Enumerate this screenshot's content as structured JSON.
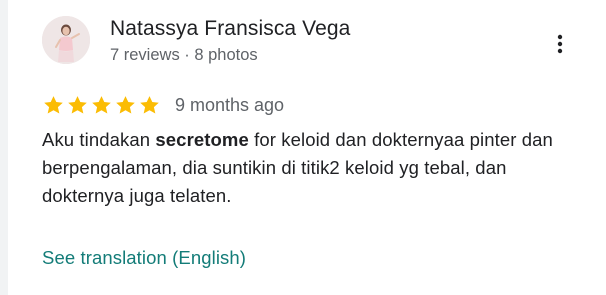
{
  "review": {
    "reviewer": {
      "name": "Natassya Fransisca Vega",
      "meta": "7 reviews · 8 photos",
      "avatar": "profile-photo"
    },
    "rating": 5,
    "rating_max": 5,
    "time_ago": "9 months ago",
    "text_before": "Aku tindakan ",
    "text_bold": "secretome",
    "text_after": " for keloid dan dokternyaa pinter dan berpengalaman, dia suntikin di titik2 keloid yg tebal, dan dokternya juga telaten.",
    "translate_label": "See translation (English)",
    "more_icon": "more-vert-icon"
  },
  "colors": {
    "star": "#fbbc04",
    "link": "#137c78",
    "secondary_text": "#5f6368",
    "primary_text": "#202124"
  }
}
